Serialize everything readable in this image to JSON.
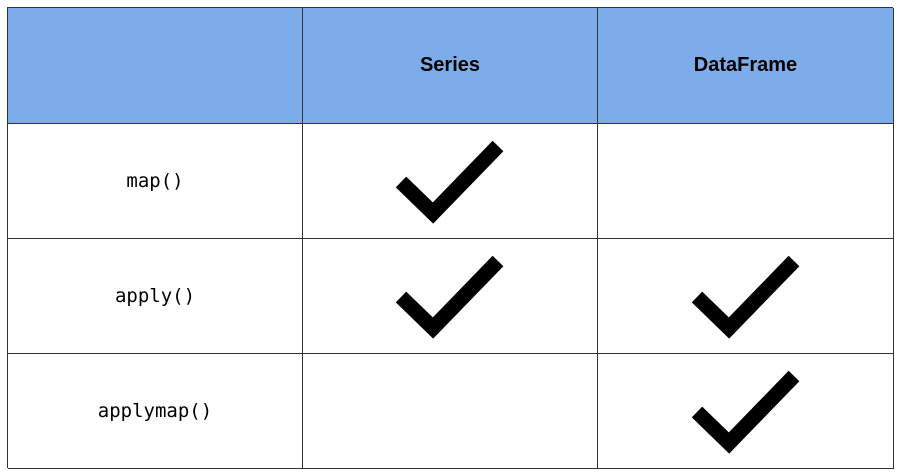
{
  "table": {
    "header": {
      "corner": "",
      "columns": [
        "Series",
        "DataFrame"
      ]
    },
    "rows": [
      {
        "label": "map()",
        "series": true,
        "dataframe": false
      },
      {
        "label": "apply()",
        "series": true,
        "dataframe": true
      },
      {
        "label": "applymap()",
        "series": false,
        "dataframe": true
      }
    ]
  },
  "colors": {
    "header_bg": "#7dacea",
    "grid_line": "#333333",
    "check": "#000000"
  },
  "icons": {
    "check": "check-icon"
  }
}
